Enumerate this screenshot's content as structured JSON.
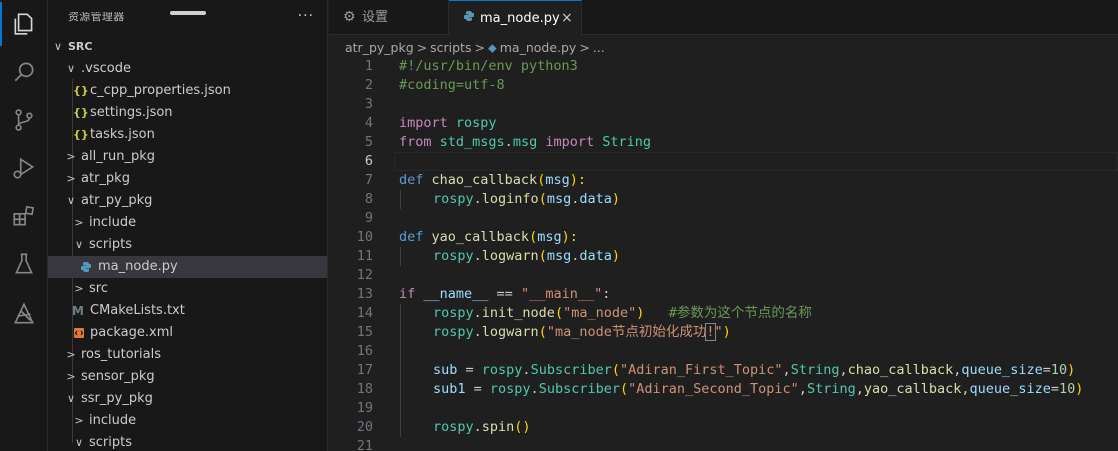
{
  "colors": {
    "accent": "#0078d4",
    "python_icon": "#519aba",
    "json_icon": "#cbcb41",
    "cmake_icon": "#6d8086",
    "xml_icon": "#e37933"
  },
  "sidebar": {
    "title": "资源管理器",
    "more": "···",
    "tree": [
      {
        "label": "SRC",
        "chevron": "∨",
        "root": true
      },
      {
        "label": ".vscode",
        "chevron": "∨"
      },
      {
        "label": "c_cpp_properties.json",
        "icon": "{}"
      },
      {
        "label": "settings.json",
        "icon": "{}"
      },
      {
        "label": "tasks.json",
        "icon": "{}"
      },
      {
        "label": "all_run_pkg",
        "chevron": ">"
      },
      {
        "label": "atr_pkg",
        "chevron": ">"
      },
      {
        "label": "atr_py_pkg",
        "chevron": "∨"
      },
      {
        "label": "include",
        "chevron": ">"
      },
      {
        "label": "scripts",
        "chevron": "∨"
      },
      {
        "label": "ma_node.py",
        "icon": "python"
      },
      {
        "label": "src",
        "chevron": ">"
      },
      {
        "label": "CMakeLists.txt",
        "icon": "M"
      },
      {
        "label": "package.xml",
        "icon": "xml"
      },
      {
        "label": "ros_tutorials",
        "chevron": ">"
      },
      {
        "label": "sensor_pkg",
        "chevron": ">"
      },
      {
        "label": "ssr_py_pkg",
        "chevron": "∨"
      },
      {
        "label": "include",
        "chevron": ">"
      },
      {
        "label": "scripts",
        "chevron": "∨"
      }
    ]
  },
  "tabs": {
    "settings_label": "设置",
    "active_label": "ma_node.py",
    "close": "×"
  },
  "breadcrumb": [
    "atr_py_pkg",
    ">",
    "scripts",
    ">",
    "ma_node.py",
    ">",
    "..."
  ],
  "editor": {
    "current_line": 6,
    "lines": [
      "1",
      "2",
      "3",
      "4",
      "5",
      "6",
      "7",
      "8",
      "9",
      "10",
      "11",
      "12",
      "13",
      "14",
      "15",
      "16",
      "17",
      "18",
      "19",
      "20",
      "21"
    ],
    "code": {
      "l1": "#!/usr/bin/env python3",
      "l2": "#coding=utf-8",
      "l4a": "import",
      "l4b": " rospy",
      "l5a": "from",
      "l5b": " std_msgs",
      "l5c": ".",
      "l5d": "msg",
      "l5e": " import",
      "l5f": " String",
      "l7a": "def",
      "l7b": " chao_callback",
      "l7c": "(",
      "l7d": "msg",
      "l7e": "):",
      "l8a": "rospy",
      "l8b": ".",
      "l8c": "loginfo",
      "l8d": "(",
      "l8e": "msg",
      "l8f": ".",
      "l8g": "data",
      "l8h": ")",
      "l10a": "def",
      "l10b": " yao_callback",
      "l10c": "(",
      "l10d": "msg",
      "l10e": "):",
      "l11a": "rospy",
      "l11b": ".",
      "l11c": "logwarn",
      "l11d": "(",
      "l11e": "msg",
      "l11f": ".",
      "l11g": "data",
      "l11h": ")",
      "l13a": "if",
      "l13b": " __name__",
      "l13c": " == ",
      "l13d": "\"__main__\"",
      "l13e": ":",
      "l14a": "rospy",
      "l14b": ".",
      "l14c": "init_node",
      "l14d": "(",
      "l14e": "\"ma_node\"",
      "l14f": ")",
      "l14g": "   #参数为这个节点的名称",
      "l15a": "rospy",
      "l15b": ".",
      "l15c": "logwarn",
      "l15d": "(",
      "l15e": "\"ma_node节点初始化成功",
      "l15f": "!",
      "l15g": "\"",
      "l15h": ")",
      "l17a": "sub",
      "l17b": " = ",
      "l17c": "rospy",
      "l17d": ".",
      "l17e": "Subscriber",
      "l17f": "(",
      "l17g": "\"Adiran_First_Topic\"",
      "l17h": ",",
      "l17i": "String",
      "l17j": ",",
      "l17k": "chao_callback",
      "l17l": ",",
      "l17m": "queue_size",
      "l17n": "=",
      "l17o": "10",
      "l17p": ")",
      "l18a": "sub1",
      "l18b": " = ",
      "l18c": "rospy",
      "l18d": ".",
      "l18e": "Subscriber",
      "l18f": "(",
      "l18g": "\"Adiran_Second_Topic\"",
      "l18h": ",",
      "l18i": "String",
      "l18j": ",",
      "l18k": "yao_callback",
      "l18l": ",",
      "l18m": "queue_size",
      "l18n": "=",
      "l18o": "10",
      "l18p": ")",
      "l20a": "rospy",
      "l20b": ".",
      "l20c": "spin",
      "l20d": "()"
    }
  }
}
